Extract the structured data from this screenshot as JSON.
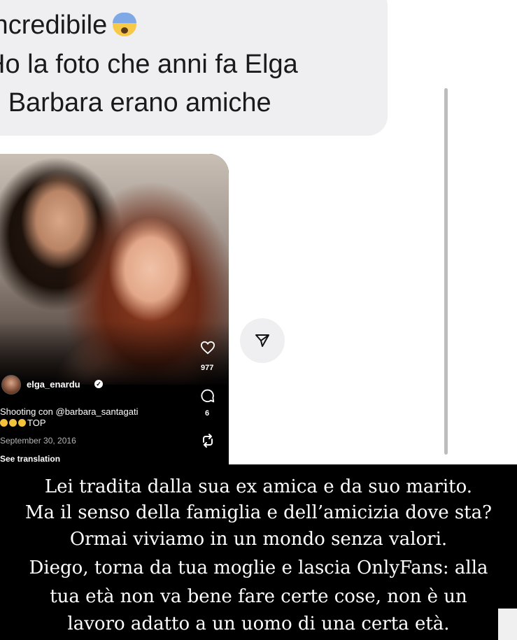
{
  "message": {
    "line1": "Incredibile",
    "line1_emoji": "anxious-face-with-sweat-emoji",
    "line2": "Ho la foto che anni fa Elga",
    "line3": "e Barbara erano amiche"
  },
  "post": {
    "username": "elga_enardu",
    "caption_line1": "Shooting con @barbara_santagati",
    "caption_line2": "TOP",
    "caption_emojis": [
      "heart-eyes-emoji",
      "heart-eyes-emoji",
      "heart-eyes-emoji"
    ],
    "date": "September 30, 2016",
    "see_translation": "See translation",
    "likes": "977",
    "comments": "6",
    "icons": [
      "heart-icon",
      "comment-icon",
      "repost-icon",
      "verified-icon"
    ]
  },
  "share_icon": "send-icon",
  "overlay": {
    "lines": [
      "Lei tradita dalla sua ex amica e da suo marito.",
      "Ma il senso della famiglia e dell’amicizia dove sta?",
      "Ormai viviamo in un mondo senza valori.",
      "Diego, torna da tua moglie e lascia OnlyFans: alla",
      "tua età non va bene fare certe cose, non è un",
      "lavoro adatto a un uomo di una certa età."
    ]
  },
  "colors": {
    "bubble": "#efeff1",
    "text": "#1a1a1a",
    "overlay_bg": "#000000",
    "overlay_text": "#ffffff"
  }
}
